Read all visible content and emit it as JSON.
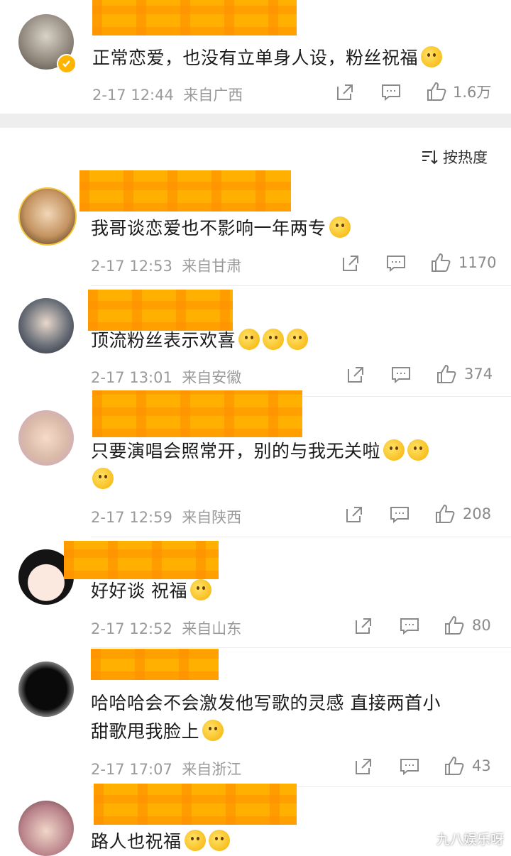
{
  "top_comment": {
    "text": "正常恋爱，也没有立单身人设，粉丝祝福",
    "time": "2-17 12:44",
    "location": "来自广西",
    "likes": "1.6万"
  },
  "sort": {
    "label": "按热度"
  },
  "comments": [
    {
      "text": "我哥谈恋爱也不影响一年两专",
      "time": "2-17 12:53",
      "location": "来自甘肃",
      "likes": "1170"
    },
    {
      "text": "顶流粉丝表示欢喜",
      "time": "2-17 13:01",
      "location": "来自安徽",
      "likes": "374"
    },
    {
      "text": "只要演唱会照常开，别的与我无关啦",
      "time": "2-17 12:59",
      "location": "来自陕西",
      "likes": "208"
    },
    {
      "text": "好好谈 祝福",
      "time": "2-17 12:52",
      "location": "来自山东",
      "likes": "80"
    },
    {
      "text_line1": "哈哈哈会不会激发他写歌的灵感 直接两首小",
      "text_line2": "甜歌甩我脸上",
      "time": "2-17 17:07",
      "location": "来自浙江",
      "likes": "43"
    },
    {
      "text": "路人也祝福"
    }
  ],
  "watermark": "九八娱乐呀",
  "icons": {
    "repost": "repost-icon",
    "comment": "comment-icon",
    "like": "thumbs-up-icon",
    "sort": "sort-icon",
    "verified": "verified-badge-icon"
  },
  "colors": {
    "highlight": "#ffb000",
    "meta": "#9a9a9a",
    "accent": "#333333",
    "verified": "#ffb400"
  }
}
